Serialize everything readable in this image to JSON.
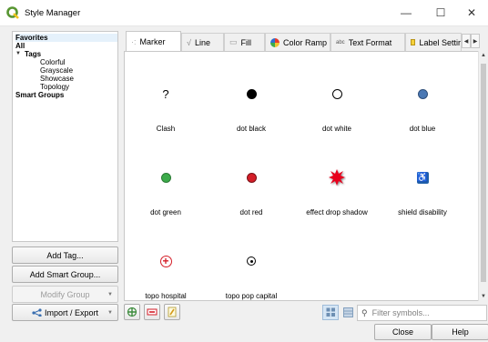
{
  "window": {
    "title": "Style Manager",
    "icon": "qgis-logo-icon"
  },
  "sidebar": {
    "items": [
      {
        "label": "Favorites"
      },
      {
        "label": "All"
      },
      {
        "label": "Tags"
      },
      {
        "label": "Colorful"
      },
      {
        "label": "Grayscale"
      },
      {
        "label": "Showcase"
      },
      {
        "label": "Topology"
      },
      {
        "label": "Smart Groups"
      }
    ],
    "add_tag": "Add Tag...",
    "add_smart_group": "Add Smart Group...",
    "modify_group": "Modify Group",
    "import_export": "Import / Export"
  },
  "tabs": [
    {
      "label": "Marker",
      "icon": "marker-icon",
      "active": true
    },
    {
      "label": "Line",
      "icon": "line-icon"
    },
    {
      "label": "Fill",
      "icon": "fill-icon"
    },
    {
      "label": "Color Ramp",
      "icon": "color-ramp-icon"
    },
    {
      "label": "Text Format",
      "icon": "text-format-icon"
    },
    {
      "label": "Label Settir",
      "icon": "label-settings-icon"
    }
  ],
  "symbols": [
    {
      "label": "Clash",
      "glyph": "?",
      "color": "#000000"
    },
    {
      "label": "dot  black",
      "color": "#000000"
    },
    {
      "label": "dot  white",
      "color": "#ffffff"
    },
    {
      "label": "dot blue",
      "color": "#4a78b4"
    },
    {
      "label": "dot green",
      "color": "#3cab4a"
    },
    {
      "label": "dot red",
      "color": "#d41e28"
    },
    {
      "label": "effect drop shadow",
      "color": "#e8001c"
    },
    {
      "label": "shield disability",
      "glyph": "♿",
      "color": "#1f5fa8"
    },
    {
      "label": "topo hospital",
      "glyph": "+",
      "color": "#d41e28"
    },
    {
      "label": "topo pop capital",
      "color": "#000000"
    }
  ],
  "filter": {
    "placeholder": "Filter symbols..."
  },
  "buttons": {
    "close": "Close",
    "help": "Help"
  }
}
